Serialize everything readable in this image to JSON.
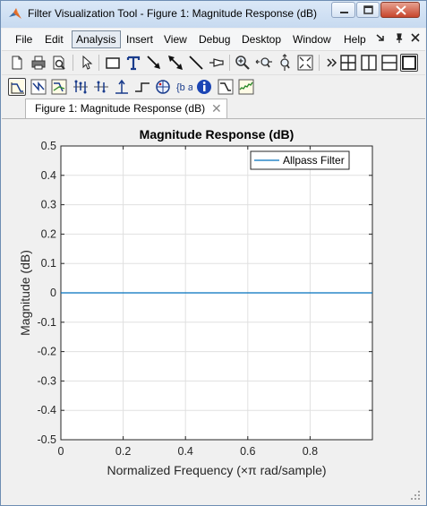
{
  "window": {
    "title": "Filter Visualization Tool - Figure 1: Magnitude Response (dB)"
  },
  "menu": [
    {
      "label": "File"
    },
    {
      "label": "Edit"
    },
    {
      "label": "Analysis"
    },
    {
      "label": "Insert"
    },
    {
      "label": "View"
    },
    {
      "label": "Debug"
    },
    {
      "label": "Desktop"
    },
    {
      "label": "Window"
    },
    {
      "label": "Help"
    }
  ],
  "toolbar1": [
    "new-figure-icon",
    "print-icon",
    "print-preview-icon",
    "pointer-icon",
    "rectangle-icon",
    "text-icon",
    "arrow-icon",
    "double-arrow-icon",
    "line-icon",
    "pin-icon",
    "zoom-in-icon",
    "zoom-x-icon",
    "zoom-y-icon",
    "full-view-icon",
    "overflow-icon",
    "tile-icon",
    "split-horizontal-icon",
    "split-vertical-icon",
    "maximize-icon"
  ],
  "toolbar2": [
    "magnitude-response-icon",
    "phase-response-icon",
    "magnitude-phase-icon",
    "group-delay-icon",
    "phase-delay-icon",
    "impulse-response-icon",
    "step-response-icon",
    "pole-zero-icon",
    "filter-coefficients-icon",
    "filter-info-icon",
    "magnitude-estimate-icon",
    "noise-psd-icon"
  ],
  "tab": {
    "label": "Figure 1: Magnitude Response (dB)"
  },
  "colors": {
    "line": "#0072bd",
    "grid": "#e0e0e0",
    "axes": "#262626"
  },
  "chart_data": {
    "type": "line",
    "title": "Magnitude Response (dB)",
    "xlabel": "Normalized Frequency (×π rad/sample)",
    "ylabel": "Magnitude (dB)",
    "xlim": [
      0,
      1
    ],
    "ylim": [
      -0.5,
      0.5
    ],
    "xticks": [
      0,
      0.2,
      0.4,
      0.6,
      0.8
    ],
    "xtick_labels": [
      "0",
      "0.2",
      "0.4",
      "0.6",
      "0.8"
    ],
    "yticks": [
      0.5,
      0.4,
      0.3,
      0.2,
      0.1,
      0,
      -0.1,
      -0.2,
      -0.3,
      -0.4,
      -0.5
    ],
    "ytick_labels": [
      "0.5",
      "0.4",
      "0.3",
      "0.2",
      "0.1",
      "0",
      "-0.1",
      "-0.2",
      "-0.3",
      "-0.4",
      "-0.5"
    ],
    "grid": true,
    "legend_position": "top-right",
    "series": [
      {
        "name": "Allpass Filter",
        "x": [
          0,
          1
        ],
        "y": [
          0,
          0
        ]
      }
    ]
  }
}
